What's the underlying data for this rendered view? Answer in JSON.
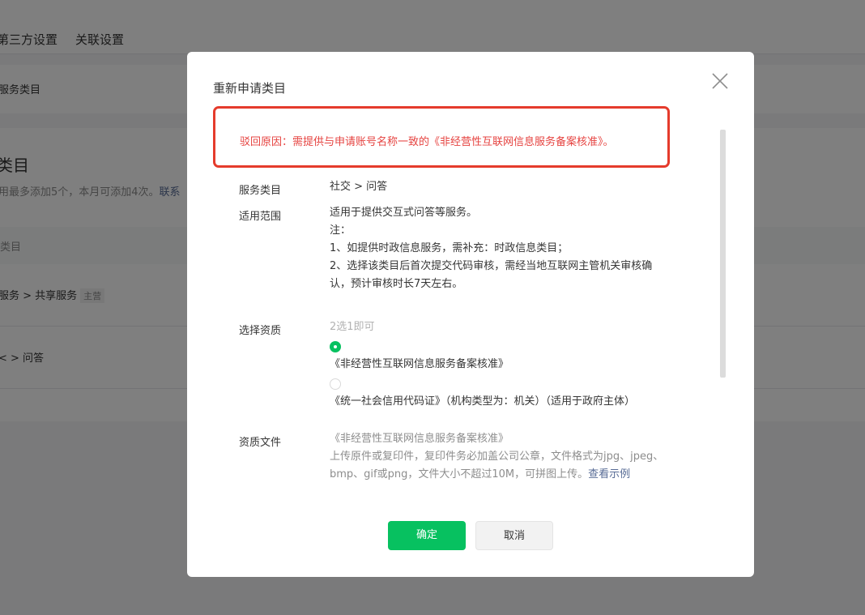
{
  "background": {
    "tabs": [
      "第三方设置",
      "关联设置"
    ],
    "section_title": "服务类目",
    "card_heading": "类目",
    "card_desc": "用最多添加5个，本月可添加4次。",
    "card_desc_link": "联系",
    "table_header": "类目",
    "rows": [
      {
        "path": "服务  >  共享服务",
        "tag": "主营"
      },
      {
        "path": "<  >  问答",
        "tag": ""
      }
    ]
  },
  "dialog": {
    "title": "重新申请类目",
    "reject_reason": "驳回原因：需提供与申请账号名称一致的《非经营性互联网信息服务备案核准》。",
    "fields": {
      "category_label": "服务类目",
      "category_value": "社交 > 问答",
      "scope_label": "适用范围",
      "scope_lines": [
        "适用于提供交互式问答等服务。",
        "注：",
        "1、如提供时政信息服务，需补充：时政信息类目；",
        "2、选择该类目后首次提交代码审核，需经当地互联网主管机关审核确",
        "认，预计审核时长7天左右。"
      ],
      "qualification_label": "选择资质",
      "qualification_hint": "2选1即可",
      "options": [
        {
          "label": "《非经营性互联网信息服务备案核准》",
          "selected": true
        },
        {
          "label": "《统一社会信用代码证》（机构类型为：机关）（适用于政府主体）",
          "selected": false
        }
      ],
      "file_label": "资质文件",
      "file_name": "《非经营性互联网信息服务备案核准》",
      "file_desc_1": "上传原件或复印件，复印件务必加盖公司公章，文件格式为jpg、jpeg、",
      "file_desc_2": "bmp、gif或png，文件大小不超过10M，可拼图上传。",
      "file_example_link": "查看示例"
    },
    "confirm_label": "确定",
    "cancel_label": "取消"
  },
  "colors": {
    "accent_green": "#07c160",
    "error_red": "#e64340",
    "highlight_box": "#e53b2c",
    "link_blue": "#576b95"
  }
}
